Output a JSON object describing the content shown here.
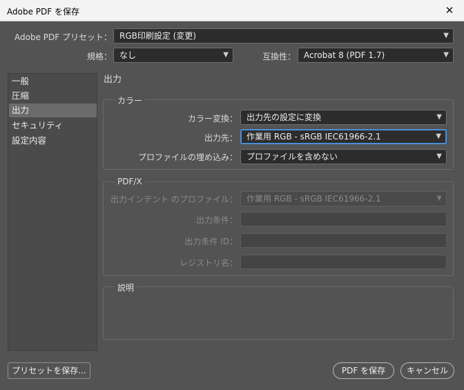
{
  "window": {
    "title": "Adobe PDF を保存",
    "close_glyph": "✕"
  },
  "preset": {
    "label": "Adobe PDF プリセット：",
    "value": "RGB印刷設定 (変更)"
  },
  "standard": {
    "label": "規格：",
    "value": "なし"
  },
  "compatibility": {
    "label": "互換性：",
    "value": "Acrobat 8 (PDF 1.7)"
  },
  "sidebar": {
    "items": [
      {
        "label": "一般"
      },
      {
        "label": "圧縮"
      },
      {
        "label": "出力"
      },
      {
        "label": "セキュリティ"
      },
      {
        "label": "設定内容"
      }
    ],
    "selected_index": 2
  },
  "panel": {
    "heading": "出力"
  },
  "color_group": {
    "title": "カラー",
    "conversion": {
      "label": "カラー変換：",
      "value": "出力先の設定に変換"
    },
    "destination": {
      "label": "出力先：",
      "value": "作業用 RGB - sRGB IEC61966-2.1"
    },
    "profile_inclusion": {
      "label": "プロファイルの埋め込み：",
      "value": "プロファイルを含めない"
    }
  },
  "pdfx_group": {
    "title": "PDF/X",
    "output_intent": {
      "label": "出力インテント のプロファイル：",
      "value": "作業用 RGB - sRGB IEC61966-2.1"
    },
    "output_condition": {
      "label": "出力条件：",
      "value": ""
    },
    "output_condition_id": {
      "label": "出力条件 ID：",
      "value": ""
    },
    "registry_name": {
      "label": "レジストリ名：",
      "value": ""
    }
  },
  "description_group": {
    "title": "説明"
  },
  "buttons": {
    "save_preset": "プリセットを保存...",
    "save_pdf": "PDF を保存",
    "cancel": "キャンセル"
  },
  "icons": {
    "chevron": "chevron-down-icon"
  },
  "colors": {
    "background": "#535353",
    "field": "#2c2c2c",
    "focus_border": "#4a8fd8",
    "titlebar": "#f3f3f3"
  }
}
